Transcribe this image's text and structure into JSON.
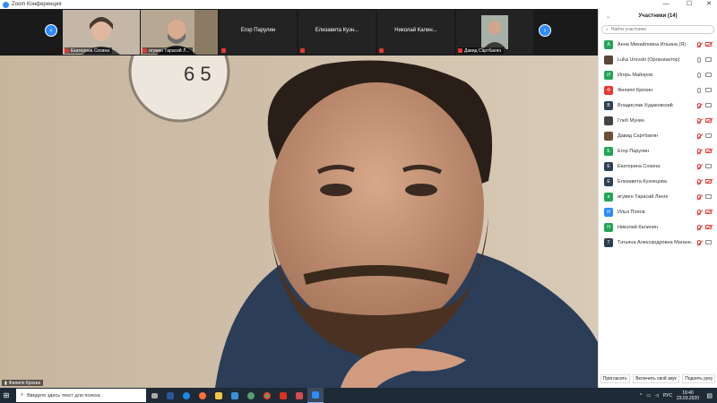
{
  "window": {
    "title": "Zoom Конференция"
  },
  "video_strip": {
    "tiles": [
      {
        "name": "",
        "label": "Екатерина Сохина",
        "type": "video"
      },
      {
        "name": "",
        "label": "игумен Тарасий Л...",
        "type": "video"
      },
      {
        "name": "Егор Парулин",
        "label": "",
        "type": "name"
      },
      {
        "name": "Елизавета  Кузн...",
        "label": "",
        "type": "name"
      },
      {
        "name": "Николай  Калин...",
        "label": "",
        "type": "name"
      },
      {
        "name": "",
        "label": "Давид Сартбаеян",
        "type": "video"
      }
    ]
  },
  "speaker": {
    "name": "Филипп Крохин"
  },
  "participants": {
    "title": "Участники (14)",
    "search_placeholder": "Найти участника",
    "list": [
      {
        "initial": "А",
        "name": "Анна Михайловна Ильина (Я)",
        "color": "#22a559",
        "mic": "off",
        "cam": "off"
      },
      {
        "initial": "",
        "name": "Luka Urovski (Организатор)",
        "color": "#5a4636",
        "mic": "on",
        "cam": "on"
      },
      {
        "initial": "И",
        "name": "Игорь Майоров",
        "color": "#22a559",
        "mic": "on",
        "cam": "on"
      },
      {
        "initial": "Ф",
        "name": "Филипп Крохин",
        "color": "#e53935",
        "mic": "on",
        "cam": "on"
      },
      {
        "initial": "В",
        "name": "Владислав Худаковский",
        "color": "#2e4053",
        "mic": "off",
        "cam": "on"
      },
      {
        "initial": "",
        "name": "Глеб Мунин",
        "color": "#444444",
        "mic": "off",
        "cam": "off"
      },
      {
        "initial": "",
        "name": "Давид Сартбаеян",
        "color": "#6b4f3a",
        "mic": "off",
        "cam": "on"
      },
      {
        "initial": "Е",
        "name": "Егор Парулин",
        "color": "#22a559",
        "mic": "off",
        "cam": "off"
      },
      {
        "initial": "Е",
        "name": "Екатерина Сохина",
        "color": "#2e4053",
        "mic": "off",
        "cam": "on"
      },
      {
        "initial": "Е",
        "name": "Елизавета Кузнецова",
        "color": "#2e4053",
        "mic": "off",
        "cam": "off"
      },
      {
        "initial": "и",
        "name": "игумен Тарасий Линге",
        "color": "#22a559",
        "mic": "off",
        "cam": "on"
      },
      {
        "initial": "И",
        "name": "Илья Попов",
        "color": "#2d8cff",
        "mic": "off",
        "cam": "off"
      },
      {
        "initial": "Н",
        "name": "Николай Калинин",
        "color": "#22a559",
        "mic": "off",
        "cam": "off"
      },
      {
        "initial": "Т",
        "name": "Татьяна Александровна Магане...",
        "color": "#2e4053",
        "mic": "off",
        "cam": "on"
      }
    ],
    "footer": {
      "invite": "Пригласить",
      "unmute": "Включить свой звук",
      "raise_hand": "Поднять руку"
    }
  },
  "taskbar": {
    "search_placeholder": "Введите здесь текст для поиска",
    "lang": "РУС",
    "time": "16:40",
    "date": "23.03.2020"
  },
  "colors": {
    "accent": "#2d8cff",
    "muted": "#e53935",
    "taskbar": "#1f2a37"
  }
}
